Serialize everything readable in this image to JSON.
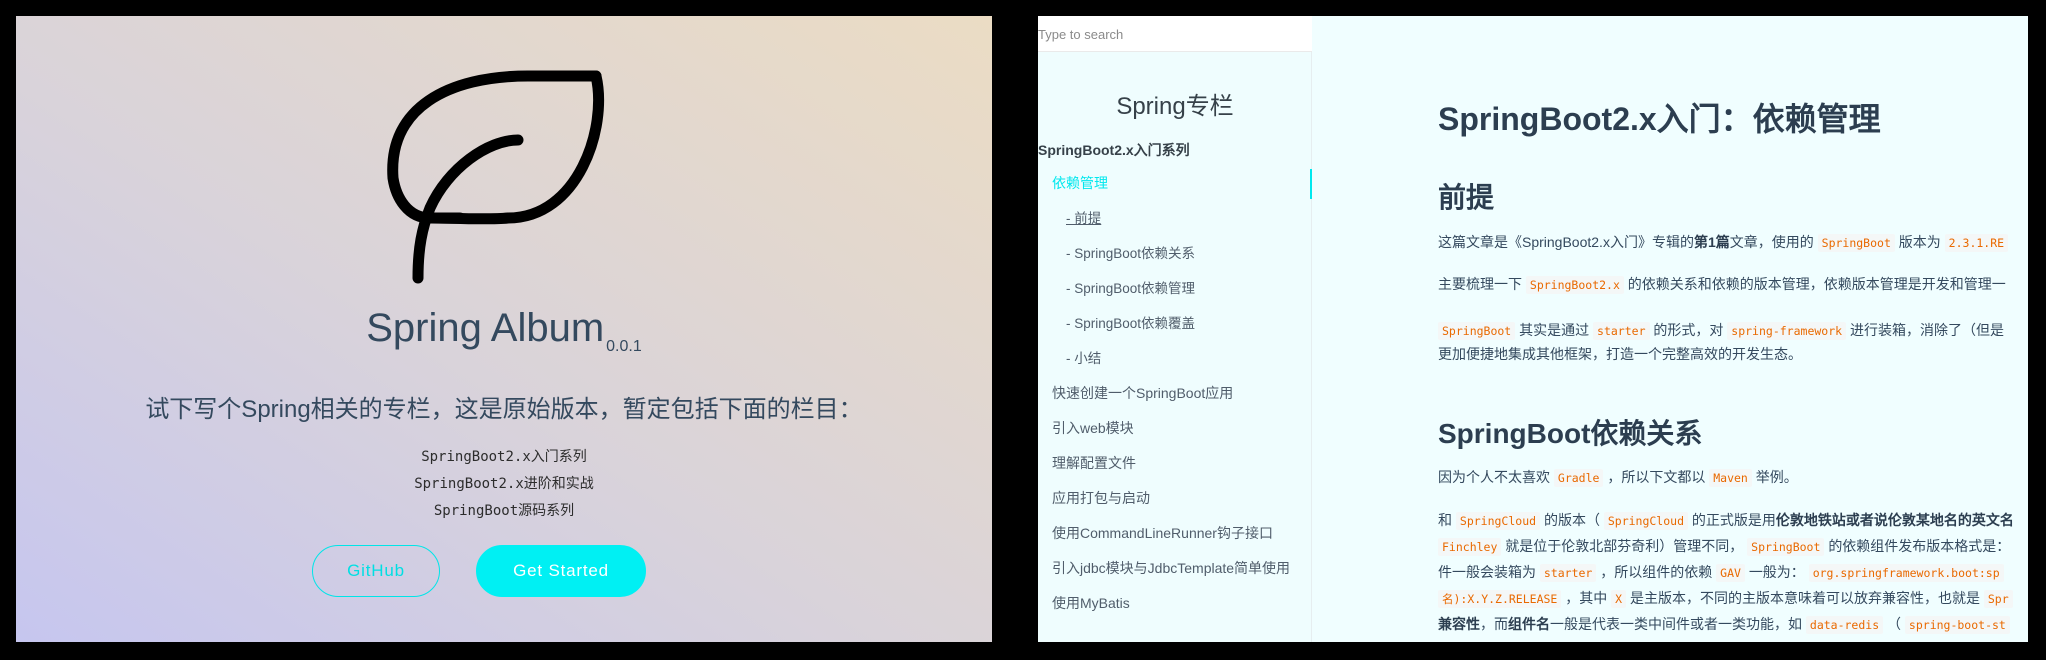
{
  "cover": {
    "title": "Spring Album",
    "version": "0.0.1",
    "description": "试下写个Spring相关的专栏，这是原始版本，暂定包括下面的栏目：",
    "series": [
      "SpringBoot2.x入门系列",
      "SpringBoot2.x进阶和实战",
      "SpringBoot源码系列"
    ],
    "github_label": "GitHub",
    "get_started_label": "Get Started",
    "accent_color": "#00f0f3"
  },
  "docs": {
    "search": {
      "placeholder": "Type to search"
    },
    "sidebar": {
      "app_name": "Spring专栏",
      "section_title": "SpringBoot2.x入门系列",
      "items": [
        {
          "label": "依赖管理",
          "level": 1,
          "active": true
        },
        {
          "label": "- 前提",
          "level": 2
        },
        {
          "label": "- SpringBoot依赖关系",
          "level": 2
        },
        {
          "label": "- SpringBoot依赖管理",
          "level": 2
        },
        {
          "label": "- SpringBoot依赖覆盖",
          "level": 2
        },
        {
          "label": "- 小结",
          "level": 2
        },
        {
          "label": "快速创建一个SpringBoot应用",
          "level": 1
        },
        {
          "label": "引入web模块",
          "level": 1
        },
        {
          "label": "理解配置文件",
          "level": 1
        },
        {
          "label": "应用打包与启动",
          "level": 1
        },
        {
          "label": "使用CommandLineRunner钩子接口",
          "level": 1
        },
        {
          "label": "引入jdbc模块与JdbcTemplate简单使用",
          "level": 1
        },
        {
          "label": "使用MyBatis",
          "level": 1
        }
      ]
    },
    "article": {
      "title": "SpringBoot2.x入门：依赖管理",
      "h_premise": "前提",
      "p1": [
        "这篇文章是《SpringBoot2.x入门》专辑的",
        "第1篇",
        "文章，使用的",
        "SpringBoot",
        "版本为",
        "2.3.1.RE"
      ],
      "p2": [
        "主要梳理一下",
        "SpringBoot2.x",
        "的依赖关系和依赖的版本管理，依赖版本管理是开发和管理一"
      ],
      "p3": [
        "SpringBoot",
        "其实是通过",
        "starter",
        "的形式，对",
        "spring-framework",
        "进行装箱，消除了（但是"
      ],
      "p3b": "更加便捷地集成其他框架，打造一个完整高效的开发生态。",
      "h_deps": "SpringBoot依赖关系",
      "p4": [
        "因为个人不太喜欢",
        "Gradle",
        "，所以下文都以",
        "Maven",
        "举例。"
      ],
      "p5": [
        "和",
        "SpringCloud",
        "的版本（",
        "SpringCloud",
        "的正式版是用",
        "伦敦地铁站或者说伦敦某地名的英文名"
      ],
      "p6": [
        "Finchley",
        "就是位于伦敦北部芬奇利）管理不同，",
        "SpringBoot",
        "的依赖组件发布版本格式是："
      ],
      "p7": [
        "件一般会装箱为",
        "starter",
        "，所以组件的依赖",
        "GAV",
        "一般为：",
        "org.springframework.boot:sp"
      ],
      "p8": [
        "名):X.Y.Z.RELEASE",
        "，其中",
        "X",
        "是主版本，不同的主版本意味着可以放弃兼容性，也就是",
        "Spr"
      ],
      "p9": [
        "兼容性",
        "，而",
        "组件名",
        "一般是代表一类中间件或者一类功能，如",
        "data-redis",
        "（",
        "spring-boot-st"
      ]
    }
  }
}
